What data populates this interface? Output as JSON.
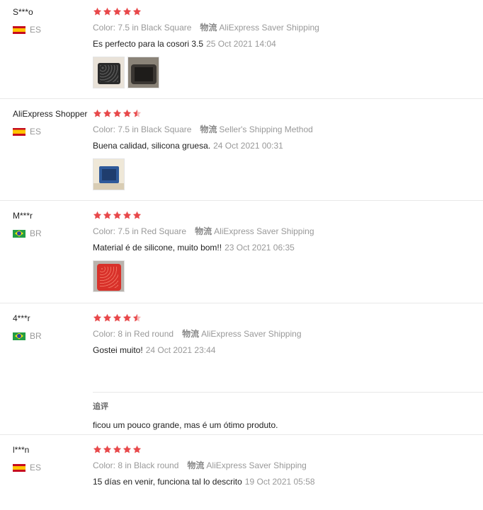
{
  "colors": {
    "star": "#e8484a",
    "muted": "#999999",
    "text": "#222222",
    "divider": "#e8e8e8"
  },
  "reviews": [
    {
      "username": "S***o",
      "country": "ES",
      "rating": 5,
      "color_text": "Color: 7.5 in Black Square",
      "logistics_label": "物流",
      "shipping": "AliExpress Saver Shipping",
      "text": "Es perfecto para la cosori 3.5",
      "date": "25 Oct 2021 14:04",
      "photos": [
        "black-silicone-liner-photo",
        "dark-liner-in-basket-photo"
      ]
    },
    {
      "username": "AliExpress Shopper",
      "country": "ES",
      "rating": 4.5,
      "color_text": "Color: 7.5 in Black Square",
      "logistics_label": "物流",
      "shipping": "Seller's Shipping Method",
      "text": "Buena calidad, silicona gruesa.",
      "date": "24 Oct 2021 00:31",
      "photos": [
        "black-liner-in-package-photo"
      ]
    },
    {
      "username": "M***r",
      "country": "BR",
      "rating": 5,
      "color_text": "Color: 7.5 in Red Square",
      "logistics_label": "物流",
      "shipping": "AliExpress Saver Shipping",
      "text": "Material é de silicone, muito bom!!",
      "date": "23 Oct 2021 06:35",
      "photos": [
        "red-silicone-liner-photo"
      ]
    },
    {
      "username": "4***r",
      "country": "BR",
      "rating": 4.5,
      "color_text": "Color: 8 in Red round",
      "logistics_label": "物流",
      "shipping": "AliExpress Saver Shipping",
      "text": "Gostei muito!",
      "date": "24 Oct 2021 23:44",
      "photos": [],
      "additional": {
        "label": "追评",
        "text": "ficou um pouco grande, mas é um ótimo produto."
      }
    },
    {
      "username": "l***n",
      "country": "ES",
      "rating": 5,
      "color_text": "Color: 8 in Black round",
      "logistics_label": "物流",
      "shipping": "AliExpress Saver Shipping",
      "text": "15 días en venir, funciona tal lo descrito",
      "date": "19 Oct 2021 05:58",
      "photos": []
    }
  ]
}
